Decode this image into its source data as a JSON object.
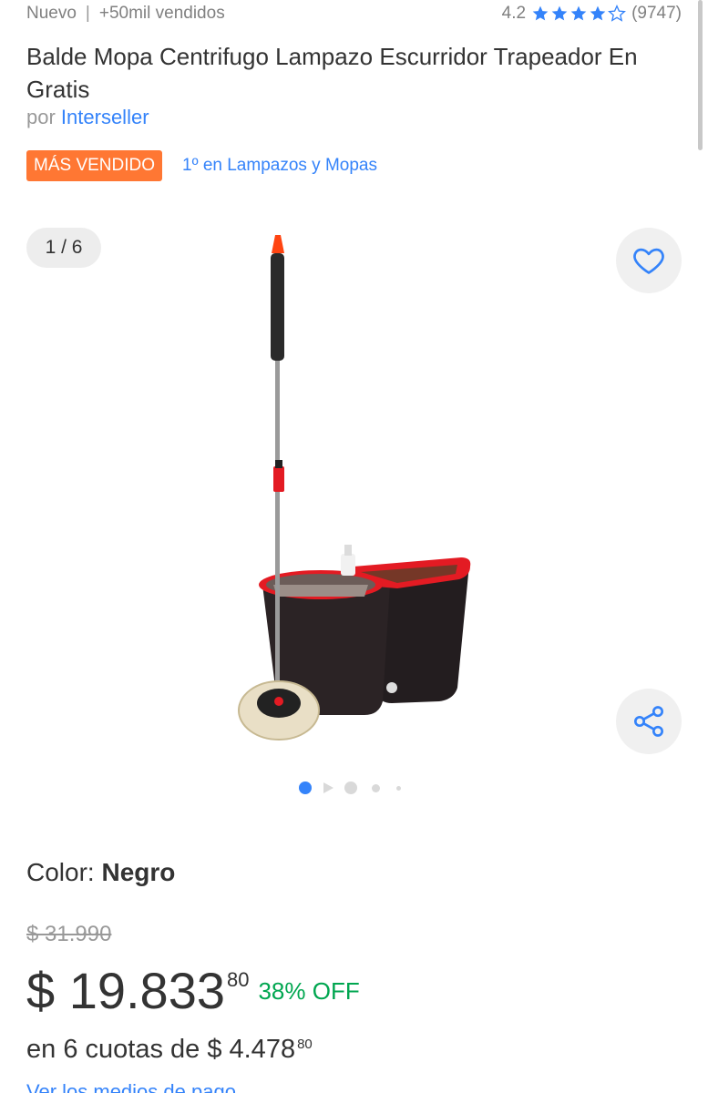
{
  "top": {
    "condition": "Nuevo",
    "separator": "|",
    "sold": "+50mil vendidos",
    "rating_value": "4.2",
    "rating_fraction": 0.84,
    "review_count": "(9747)"
  },
  "product": {
    "title": "Balde Mopa Centrifugo Lampazo Escurridor Trapeador En Gratis",
    "seller_prefix": "por",
    "seller_name": "Interseller",
    "badge": "MÁS VENDIDO",
    "ranking": "1º en Lampazos y Mopas"
  },
  "gallery": {
    "counter": "1 / 6",
    "favorite_icon": "heart-icon",
    "share_icon": "share-icon",
    "dot_count": 5,
    "active_dot": 0
  },
  "variant": {
    "label": "Color:",
    "value": "Negro"
  },
  "pricing": {
    "original": "$ 31.990",
    "current_main": "$ 19.833",
    "current_cents": "80",
    "discount": "38% OFF",
    "installments_text": "en 6 cuotas de $ 4.478",
    "installments_cents": "80",
    "payment_link": "Ver los medios de pago"
  },
  "colors": {
    "accent_blue": "#3483fa",
    "badge_orange": "#ff7733",
    "discount_green": "#00a650"
  }
}
